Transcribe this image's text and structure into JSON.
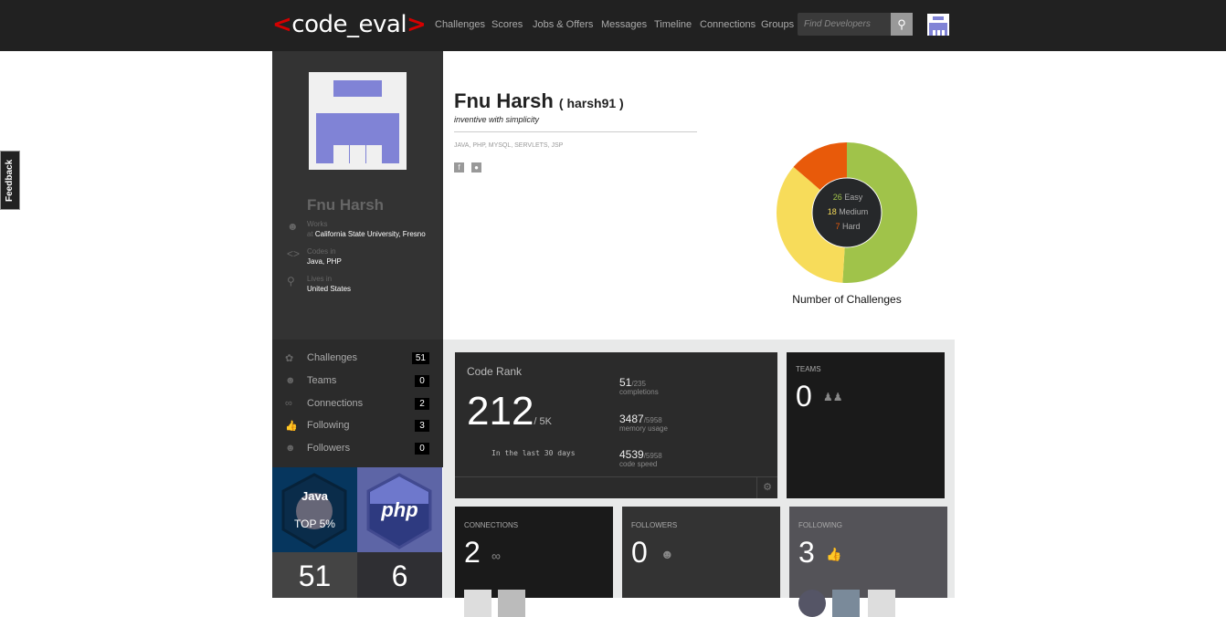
{
  "header": {
    "logo": "code_eval",
    "nav": [
      "Challenges",
      "Scores",
      "Jobs & Offers",
      "Messages",
      "Timeline",
      "Connections",
      "Groups"
    ],
    "search_placeholder": "Find Developers",
    "search_icon": "search-icon"
  },
  "feedback": "Feedback",
  "profile": {
    "name": "Fnu Harsh",
    "username": "( harsh91 )",
    "tagline": "inventive with simplicity",
    "skills": "JAVA, PHP, MYSQL, SERVLETS, JSP",
    "works_label": "Works",
    "works_prefix": "at",
    "works_value": "California State University, Fresno",
    "codes_label": "Codes in",
    "codes_value": "Java, PHP",
    "lives_label": "Lives in",
    "lives_value": "United States"
  },
  "stats": [
    {
      "label": "Challenges",
      "count": "51"
    },
    {
      "label": "Teams",
      "count": "0"
    },
    {
      "label": "Connections",
      "count": "2"
    },
    {
      "label": "Following",
      "count": "3"
    },
    {
      "label": "Followers",
      "count": "0"
    }
  ],
  "badges": [
    {
      "lang": "Java",
      "rank": "TOP 5%",
      "count": "51"
    },
    {
      "lang": "php",
      "count": "6"
    }
  ],
  "chart": {
    "title": "Number of Challenges",
    "segments": [
      {
        "value": 26,
        "label": "Easy",
        "color": "#a0c34a"
      },
      {
        "value": 18,
        "label": "Medium",
        "color": "#f7dc5a"
      },
      {
        "value": 7,
        "label": "Hard",
        "color": "#e85a0a"
      }
    ]
  },
  "coderank": {
    "title": "Code Rank",
    "rank": "212",
    "total": "/  5K",
    "period": "In the last 30 days",
    "completions": {
      "value": "51",
      "of": "/235",
      "label": "completions"
    },
    "memory": {
      "value": "3487",
      "of": "/5958",
      "label": "memory usage"
    },
    "speed": {
      "value": "4539",
      "of": "/5958",
      "label": "code speed"
    }
  },
  "teams": {
    "title": "TEAMS",
    "count": "0"
  },
  "connections": {
    "title": "CONNECTIONS",
    "count": "2"
  },
  "followers": {
    "title": "FOLLOWERS",
    "count": "0"
  },
  "following": {
    "title": "FOLLOWING",
    "count": "3"
  }
}
